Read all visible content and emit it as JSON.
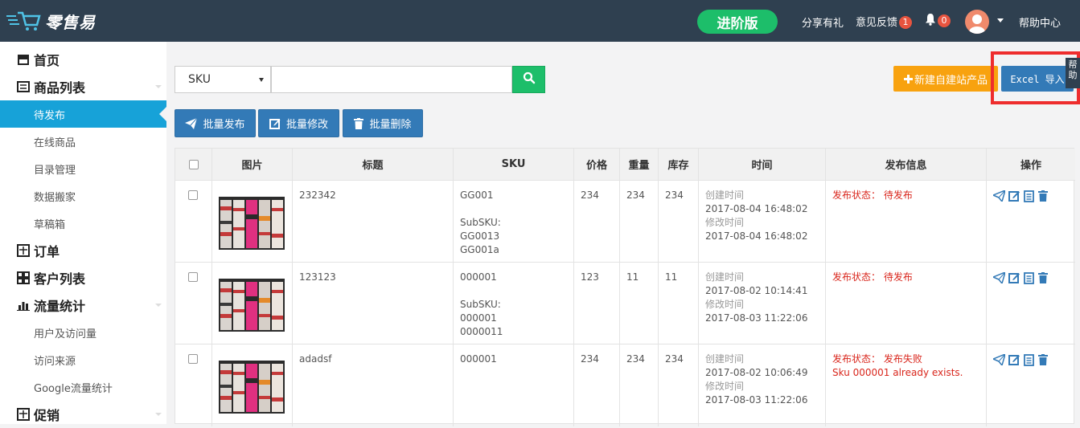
{
  "header": {
    "logo_text": "零售易",
    "edition": "进阶版",
    "share": "分享有礼",
    "feedback": "意见反馈",
    "feedback_count": "1",
    "notice_count": "0",
    "help": "帮助中心"
  },
  "sidebar": {
    "home": "首页",
    "products": "商品列表",
    "products_sub": [
      "待发布",
      "在线商品",
      "目录管理",
      "数据搬家",
      "草稿箱"
    ],
    "orders": "订单",
    "customers": "客户列表",
    "traffic": "流量统计",
    "traffic_sub": [
      "用户及访问量",
      "访问来源",
      "Google流量统计"
    ],
    "promo": "促销"
  },
  "toolbar": {
    "search_field": "SKU",
    "search_value": "",
    "new_product": "新建自建站产品",
    "excel_import": "Excel 导入",
    "side_tab": "帮助",
    "bulk_publish": "批量发布",
    "bulk_edit": "批量修改",
    "bulk_delete": "批量删除"
  },
  "table": {
    "headers": [
      "图片",
      "标题",
      "SKU",
      "价格",
      "重量",
      "库存",
      "时间",
      "发布信息",
      "操作"
    ],
    "labels": {
      "created": "创建时间",
      "modified": "修改时间",
      "subsku": "SubSKU:",
      "status": "发布状态："
    },
    "rows": [
      {
        "title": "232342",
        "sku": "GG001",
        "subsku": [
          "GG0013",
          "GG001a"
        ],
        "price": "234",
        "weight": "234",
        "stock": "234",
        "created": "2017-08-04 16:48:02",
        "modified": "2017-08-04 16:48:02",
        "status": "待发布",
        "error": ""
      },
      {
        "title": "123123",
        "sku": "000001",
        "subsku": [
          "000001",
          "0000011"
        ],
        "price": "123",
        "weight": "11",
        "stock": "11",
        "created": "2017-08-02 10:14:41",
        "modified": "2017-08-03 11:22:06",
        "status": "待发布",
        "error": ""
      },
      {
        "title": "adadsf",
        "sku": "000001",
        "subsku": [],
        "price": "234",
        "weight": "234",
        "stock": "234",
        "created": "2017-08-02 10:06:49",
        "modified": "2017-08-03 11:22:06",
        "status": "发布失败",
        "error": "Sku 000001 already exists."
      }
    ]
  },
  "colors": {
    "header_bg": "#2f4050",
    "accent_green": "#1dbe6a",
    "primary_blue": "#337ab7",
    "active_nav": "#17a2d8",
    "orange": "#f8a20f",
    "error_red": "#d9261c"
  }
}
